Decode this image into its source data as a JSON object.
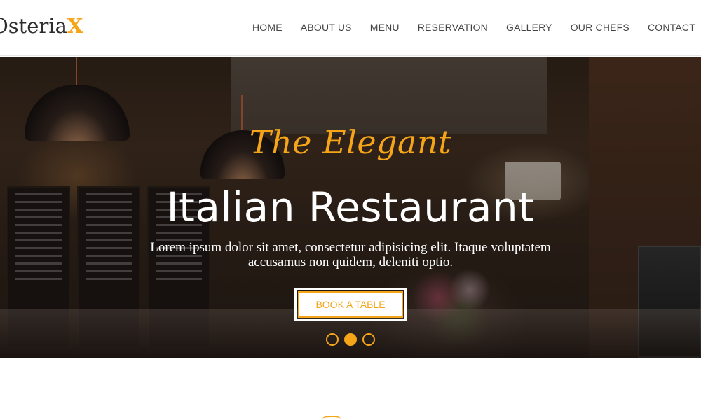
{
  "brand": {
    "name_main": "Osteria",
    "name_accent": "X",
    "accent_color": "#f6a519"
  },
  "nav": {
    "items": [
      {
        "label": "HOME"
      },
      {
        "label": "ABOUT US"
      },
      {
        "label": "MENU"
      },
      {
        "label": "RESERVATION"
      },
      {
        "label": "GALLERY"
      },
      {
        "label": "OUR CHEFS"
      },
      {
        "label": "CONTACT"
      }
    ]
  },
  "hero": {
    "script_title": "The Elegant",
    "title": "Italian Restaurant",
    "subtitle": "Lorem ipsum dolor sit amet, consectetur adipisicing elit. Itaque voluptatem accusamus non quidem, deleniti optio.",
    "cta_label": "BOOK A TABLE",
    "slider": {
      "count": 3,
      "active_index": 1
    }
  }
}
